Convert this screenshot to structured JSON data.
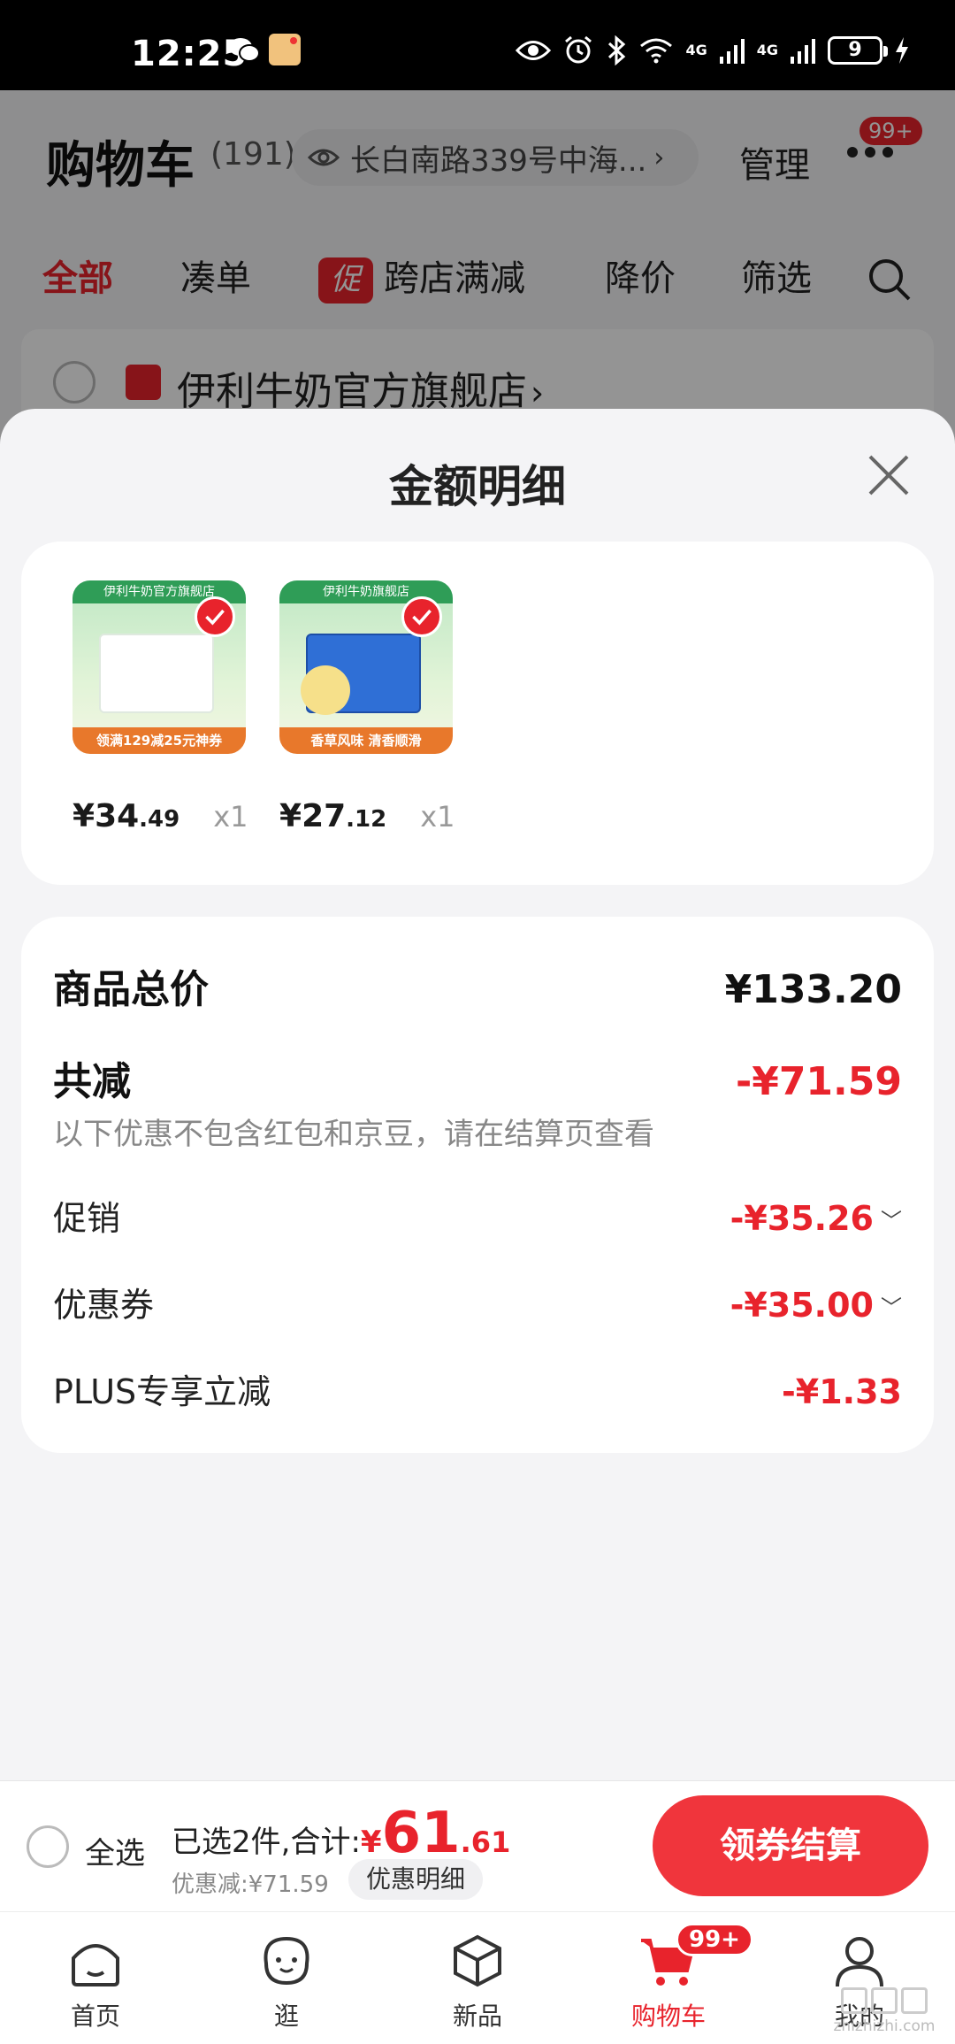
{
  "status_bar": {
    "time": "12:25",
    "battery": "9",
    "network_1": "4G",
    "network_2": "4G"
  },
  "header": {
    "title": "购物车",
    "count": "(191)",
    "address": "长白南路339号中海...",
    "manage": "管理",
    "more_badge": "99+"
  },
  "tabs": {
    "all": "全部",
    "bundle": "凑单",
    "promo_tag": "促",
    "cross_store": "跨店满减",
    "price_drop": "降价",
    "filter": "筛选"
  },
  "store": {
    "name": "伊利牛奶官方旗舰店"
  },
  "sheet": {
    "title": "金额明细",
    "products": [
      {
        "brand": "伊利牛奶官方旗舰店",
        "banner": "领满129减25元神券",
        "yen": "¥",
        "price_int": "34",
        "price_dec": ".49",
        "qty": "x1"
      },
      {
        "brand": "伊利牛奶旗舰店",
        "banner": "香草风味 清香顺滑",
        "yen": "¥",
        "price_int": "27",
        "price_dec": ".12",
        "qty": "x1"
      }
    ],
    "summary": {
      "total_label": "商品总价",
      "total_value": "¥133.20",
      "reduce_label": "共减",
      "reduce_value": "-¥71.59",
      "note": "以下优惠不包含红包和京豆，请在结算页查看",
      "promo_label": "促销",
      "promo_value": "-¥35.26",
      "coupon_label": "优惠券",
      "coupon_value": "-¥35.00",
      "plus_label": "PLUS专享立减",
      "plus_value": "-¥1.33"
    }
  },
  "checkout": {
    "select_all": "全选",
    "selected_text": "已选2件,合计:",
    "total_yen": "¥",
    "total_int": "61",
    "total_dec": ".61",
    "discount": "优惠减:¥71.59",
    "detail_button": "优惠明细",
    "pay_button": "领券结算"
  },
  "nav": {
    "home": "首页",
    "browse": "逛",
    "new": "新品",
    "cart": "购物车",
    "cart_badge": "99+",
    "mine": "我的"
  },
  "watermark": "zhizhizhi.com",
  "colors": {
    "accent": "#e8232c",
    "button": "#f0353c"
  }
}
